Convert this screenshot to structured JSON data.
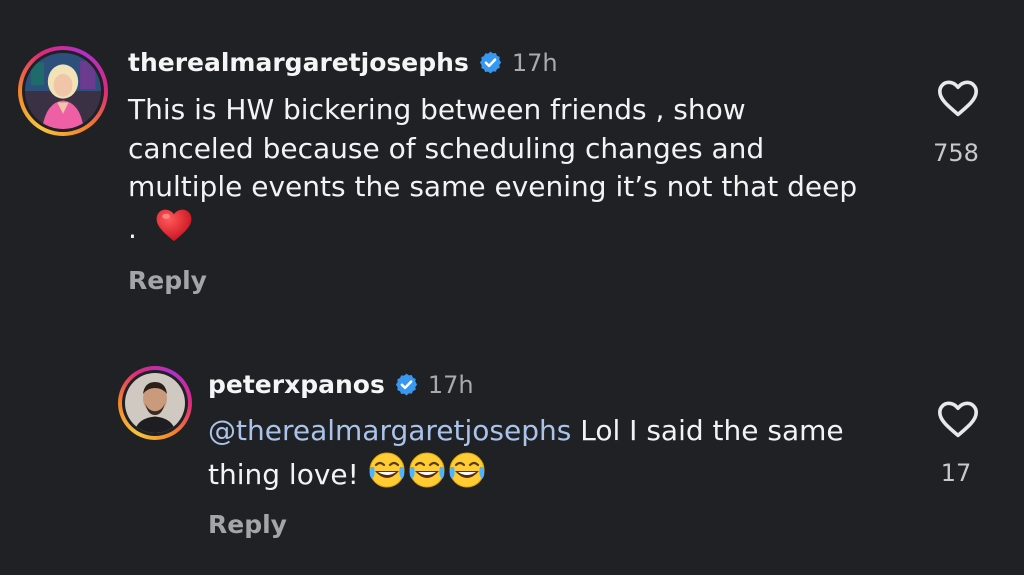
{
  "comments": [
    {
      "username": "therealmargaretjosephs",
      "time": "17h",
      "text": "This is HW bickering between friends , show canceled because of scheduling changes and multiple events the same evening it’s not that deep .",
      "emoji": "red-heart",
      "reply_label": "Reply",
      "likes": "758",
      "verified": true,
      "avatar": "profile-photo-blonde-woman-pink-dress"
    },
    {
      "username": "peterxpanos",
      "time": "17h",
      "mention": "@therealmargaretjosephs",
      "text": "Lol I said the same thing love!",
      "emoji": "laughing-crying-face ×3",
      "reply_label": "Reply",
      "likes": "17",
      "verified": true,
      "avatar": "profile-photo-man-beard"
    }
  ],
  "icons": {
    "like": "heart-outline-icon",
    "verified": "verified-badge-icon"
  },
  "colors": {
    "background": "#202124",
    "mention": "#a9c3ea",
    "verified": "#3897f0",
    "muted": "#a2a5a9"
  }
}
